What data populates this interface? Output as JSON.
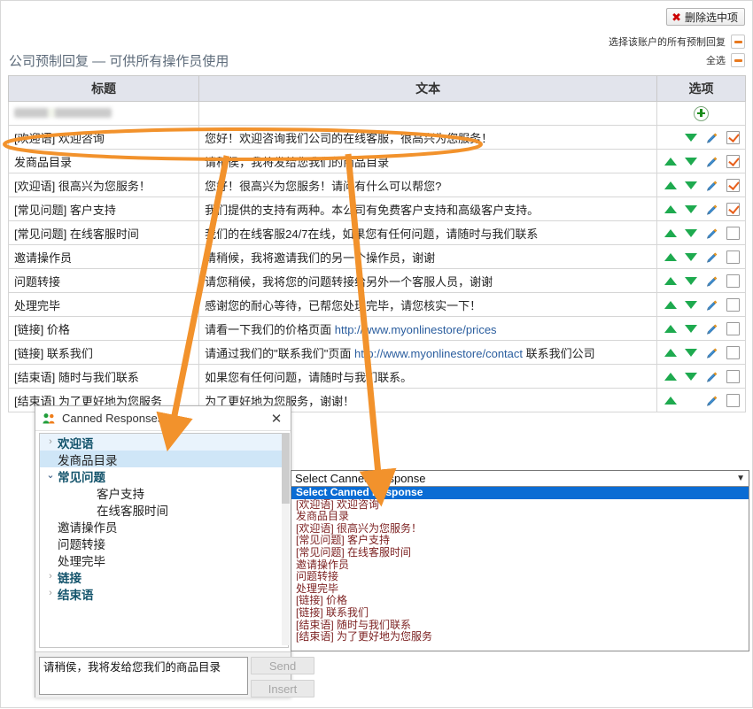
{
  "toolbar": {
    "delete_selected_label": "删除选中项",
    "delete_icon": "x-mark-icon",
    "select_all_account_label": "选择该账户的所有预制回复",
    "select_all_label": "全选",
    "minus_icon": "minus-icon",
    "accent_orange": "#e8791e",
    "delete_red": "#cc0000"
  },
  "page": {
    "title": "公司预制回复 — 可供所有操作员使用",
    "title_color": "#5d6b7a"
  },
  "table": {
    "headers": {
      "title": "标题",
      "text": "文本",
      "options": "选项"
    },
    "account_row": {
      "name_redacted": "",
      "add_icon": "plus-icon"
    },
    "rows": [
      {
        "title": "[欢迎语] 欢迎咨询",
        "text": "您好！欢迎咨询我们公司的在线客服，很高兴为您服务！",
        "up": false,
        "down": true,
        "edit": true,
        "checked": true
      },
      {
        "title": "发商品目录",
        "text": "请稍侯，我将发给您我们的商品目录",
        "up": true,
        "down": true,
        "edit": true,
        "checked": true
      },
      {
        "title": "[欢迎语] 很高兴为您服务！",
        "text": "您好！很高兴为您服务！请问有什么可以帮您?",
        "up": true,
        "down": true,
        "edit": true,
        "checked": true
      },
      {
        "title": "[常见问题] 客户支持",
        "text": "我们提供的支持有两种。本公司有免费客户支持和高级客户支持。",
        "up": true,
        "down": true,
        "edit": true,
        "checked": true
      },
      {
        "title": "[常见问题] 在线客服时间",
        "text": "我们的在线客服24/7在线，如果您有任何问题，请随时与我们联系",
        "up": true,
        "down": true,
        "edit": true,
        "checked": false
      },
      {
        "title": "邀请操作员",
        "text": "请稍候，我将邀请我们的另一个操作员，谢谢",
        "up": true,
        "down": true,
        "edit": true,
        "checked": false
      },
      {
        "title": "问题转接",
        "text": "请您稍候，我将您的问题转接给另外一个客服人员，谢谢",
        "up": true,
        "down": true,
        "edit": true,
        "checked": false
      },
      {
        "title": "处理完毕",
        "text": "感谢您的耐心等待，已帮您处理完毕，请您核实一下！",
        "up": true,
        "down": true,
        "edit": true,
        "checked": false
      },
      {
        "title": "[链接] 价格",
        "text_pre": "请看一下我们的价格页面 ",
        "text_url": "http://www.myonlinestore/prices",
        "text_post": "",
        "up": true,
        "down": true,
        "edit": true,
        "checked": false
      },
      {
        "title": "[链接] 联系我们",
        "text_pre": "请通过我们的\"联系我们\"页面 ",
        "text_url": "http://www.myonlinestore/contact",
        "text_post": " 联系我们公司",
        "up": true,
        "down": true,
        "edit": true,
        "checked": false
      },
      {
        "title": "[结束语] 随时与我们联系",
        "text": "如果您有任何问题，请随时与我们联系。",
        "up": true,
        "down": true,
        "edit": true,
        "checked": false
      },
      {
        "title": "[结束语] 为了更好地为您服务",
        "text": "为了更好地为您服务，谢谢！",
        "up": true,
        "down": false,
        "edit": true,
        "checked": false
      }
    ]
  },
  "canned_window": {
    "title": "Canned Responses",
    "app_icon": "people-icon",
    "close_icon": "close-icon",
    "tree": [
      {
        "label": "欢迎语",
        "type": "group",
        "expanded": false,
        "indent": 1,
        "highlight": "light"
      },
      {
        "label": "发商品目录",
        "type": "leaf",
        "indent": 1,
        "highlight": "blue"
      },
      {
        "label": "常见问题",
        "type": "group",
        "expanded": true,
        "indent": 1,
        "highlight": "none"
      },
      {
        "label": "客户支持",
        "type": "leaf",
        "indent": 2,
        "highlight": "none"
      },
      {
        "label": "在线客服时间",
        "type": "leaf",
        "indent": 2,
        "highlight": "none"
      },
      {
        "label": "邀请操作员",
        "type": "leaf",
        "indent": 1,
        "highlight": "none"
      },
      {
        "label": "问题转接",
        "type": "leaf",
        "indent": 1,
        "highlight": "none"
      },
      {
        "label": "处理完毕",
        "type": "leaf",
        "indent": 1,
        "highlight": "none"
      },
      {
        "label": "链接",
        "type": "group",
        "expanded": false,
        "indent": 1,
        "highlight": "none"
      },
      {
        "label": "结束语",
        "type": "group",
        "expanded": false,
        "indent": 1,
        "highlight": "none"
      }
    ],
    "message_value": "请稍侯，我将发给您我们的商品目录",
    "send_label": "Send",
    "insert_label": "Insert"
  },
  "select_dropdown": {
    "current_value": "Select Canned Response",
    "arrow_icon": "chevron-down-icon",
    "options": [
      "Select Canned Response",
      "[欢迎语] 欢迎咨询",
      "发商品目录",
      "[欢迎语] 很高兴为您服务！",
      "[常见问题] 客户支持",
      "[常见问题] 在线客服时间",
      "邀请操作员",
      "问题转接",
      "处理完毕",
      "[链接] 价格",
      "[链接] 联系我们",
      "[结束语] 随时与我们联系",
      "[结束语] 为了更好地为您服务"
    ],
    "selected_index": 0,
    "highlight_color": "#0a6cd4",
    "option_color": "#7b1f1f"
  },
  "annotations": {
    "highlight_color": "#f2922c",
    "ellipse_label": "first-row-highlight-ellipse",
    "arrow1_label": "arrow-to-canned-responses-tree",
    "arrow2_label": "arrow-to-select-dropdown"
  }
}
